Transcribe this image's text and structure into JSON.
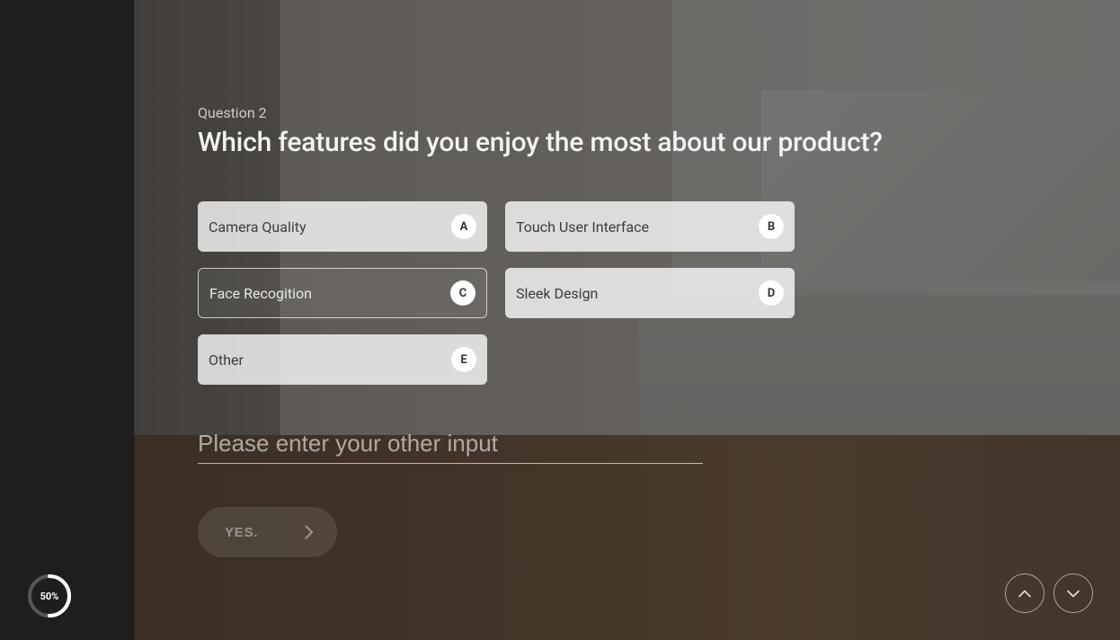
{
  "question": {
    "number_label": "Question 2",
    "title": "Which features did you enjoy the most about our product?"
  },
  "options": [
    {
      "label": "Camera Quality",
      "key": "A",
      "style": "filled"
    },
    {
      "label": "Touch User Interface",
      "key": "B",
      "style": "filled"
    },
    {
      "label": "Face Recogition",
      "key": "C",
      "style": "outlined"
    },
    {
      "label": "Sleek Design",
      "key": "D",
      "style": "filled"
    },
    {
      "label": "Other",
      "key": "E",
      "style": "filled"
    }
  ],
  "other_input": {
    "placeholder": "Please enter your other input",
    "value": ""
  },
  "submit": {
    "label": "YES."
  },
  "progress": {
    "percent": 50,
    "label": "50%"
  }
}
